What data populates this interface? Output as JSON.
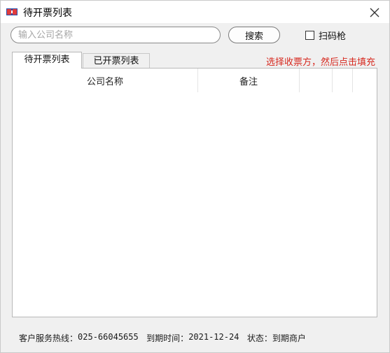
{
  "window": {
    "title": "待开票列表"
  },
  "search": {
    "placeholder": "输入公司名称",
    "value": "",
    "button_label": "搜索"
  },
  "scan_gun": {
    "label": "扫码枪",
    "checked": false
  },
  "tabs": [
    {
      "label": "待开票列表",
      "active": true
    },
    {
      "label": "已开票列表",
      "active": false
    }
  ],
  "hint": "选择收票方，然后点击填充",
  "table": {
    "columns": [
      "公司名称",
      "备注",
      "",
      "",
      ""
    ],
    "rows": []
  },
  "status": {
    "hotline_label": "客户服务热线：",
    "hotline_value": "025-66045655",
    "expire_label": "到期时间：",
    "expire_value": "2021-12-24",
    "state_label": "状态：",
    "state_value": "到期商户"
  },
  "colors": {
    "hint": "#d6281e",
    "window_bg": "#f0f0f0",
    "panel_bg": "#ffffff"
  },
  "icons": {
    "app": "app-flag-icon",
    "close": "close-icon"
  }
}
